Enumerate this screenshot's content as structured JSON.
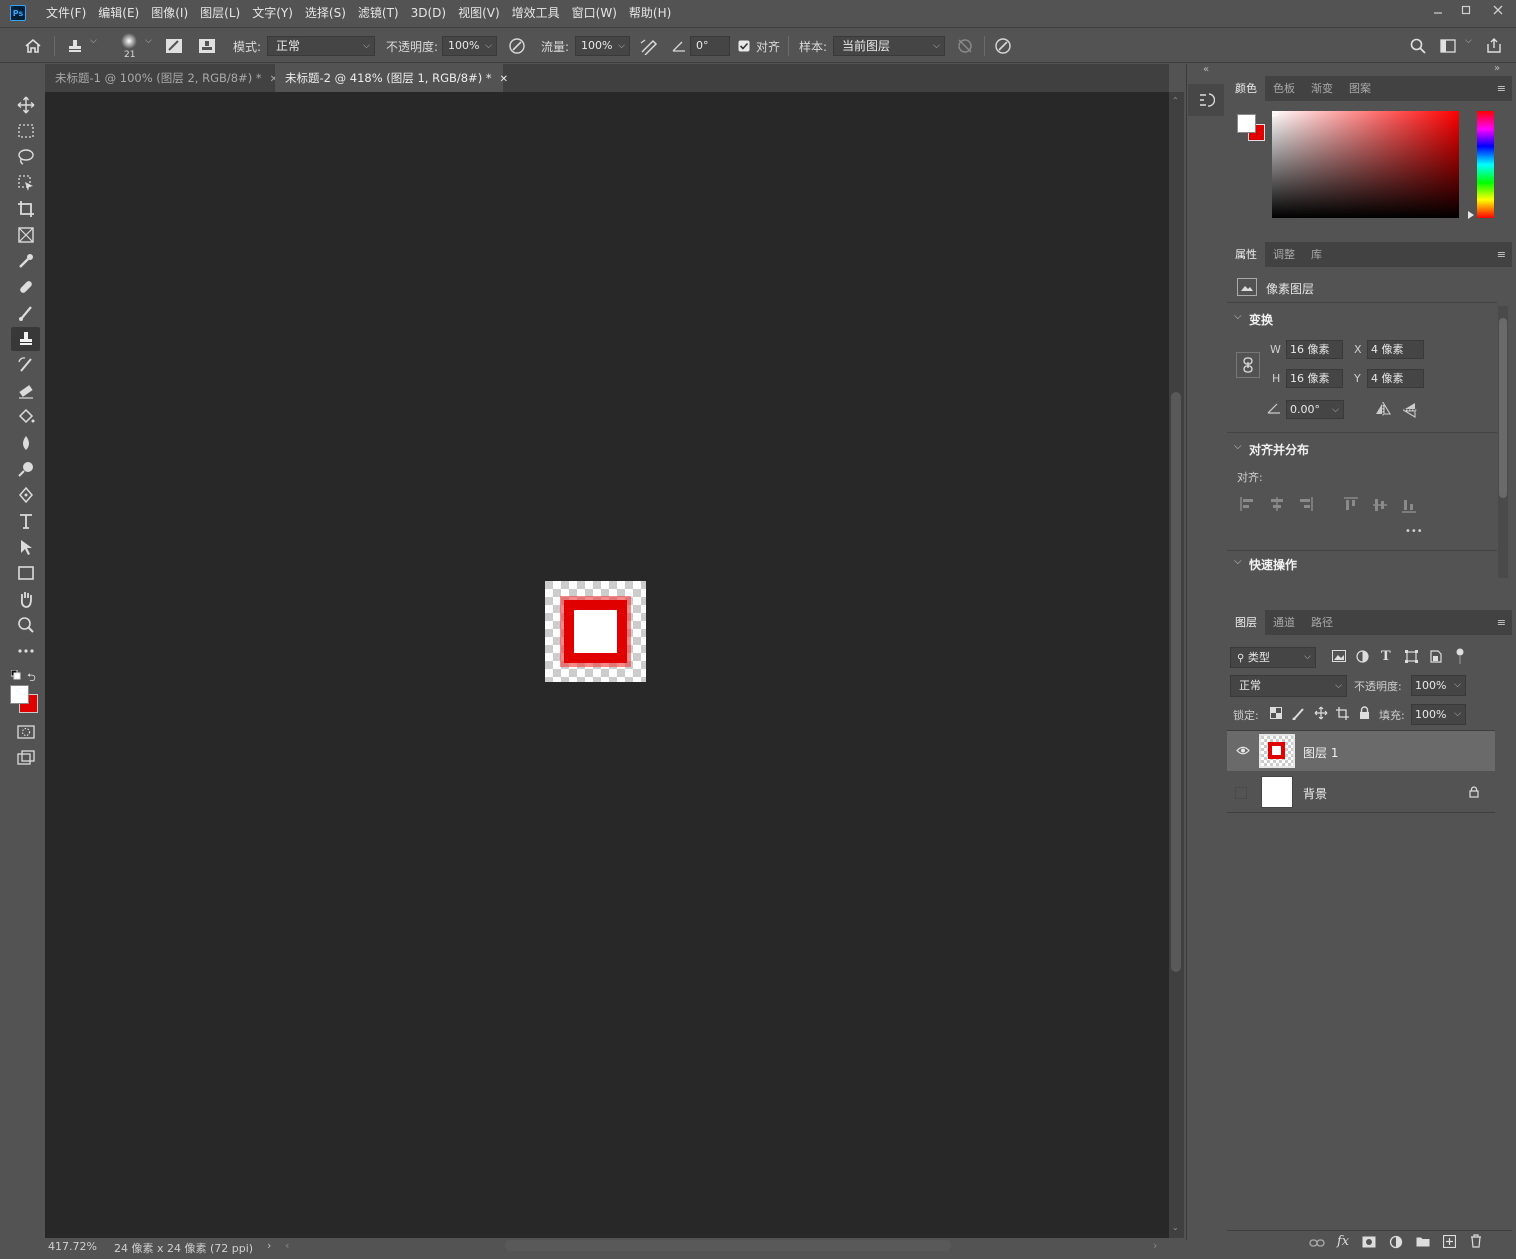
{
  "app": {
    "logo": "Ps"
  },
  "menu": [
    "文件(F)",
    "编辑(E)",
    "图像(I)",
    "图层(L)",
    "文字(Y)",
    "选择(S)",
    "滤镜(T)",
    "3D(D)",
    "视图(V)",
    "增效工具",
    "窗口(W)",
    "帮助(H)"
  ],
  "options": {
    "brush_size": "21",
    "mode_label": "模式:",
    "mode_value": "正常",
    "opacity_label": "不透明度:",
    "opacity_value": "100%",
    "flow_label": "流量:",
    "flow_value": "100%",
    "angle_value": "0°",
    "align_label": "对齐",
    "align_checked": true,
    "sample_label": "样本:",
    "sample_value": "当前图层"
  },
  "tabs": [
    {
      "label": "未标题-1 @ 100% (图层 2, RGB/8#) *",
      "active": false
    },
    {
      "label": "未标题-2 @ 418% (图层 1, RGB/8#) *",
      "active": true
    }
  ],
  "status": {
    "zoom": "417.72%",
    "doc_info": "24 像素 x 24 像素 (72 ppi)"
  },
  "color_panel": {
    "tabs": [
      "颜色",
      "色板",
      "渐变",
      "图案"
    ],
    "foreground": "#ffffff",
    "background": "#e00000"
  },
  "properties_panel": {
    "tabs": [
      "属性",
      "调整",
      "库"
    ],
    "kind": "像素图层",
    "transform_title": "变换",
    "w_label": "W",
    "w_value": "16 像素",
    "h_label": "H",
    "h_value": "16 像素",
    "x_label": "X",
    "x_value": "4 像素",
    "y_label": "Y",
    "y_value": "4 像素",
    "angle_value": "0.00°",
    "align_title": "对齐并分布",
    "align_label": "对齐:",
    "more": "•••",
    "quick_title": "快速操作"
  },
  "layers_panel": {
    "tabs": [
      "图层",
      "通道",
      "路径"
    ],
    "filter_value": "类型",
    "blend_value": "正常",
    "opacity_label": "不透明度:",
    "opacity_value": "100%",
    "lock_label": "锁定:",
    "fill_label": "填充:",
    "fill_value": "100%",
    "layers": [
      {
        "name": "图层 1",
        "visible": true,
        "selected": true
      },
      {
        "name": "背景",
        "visible": false,
        "selected": false,
        "locked": true
      }
    ]
  }
}
